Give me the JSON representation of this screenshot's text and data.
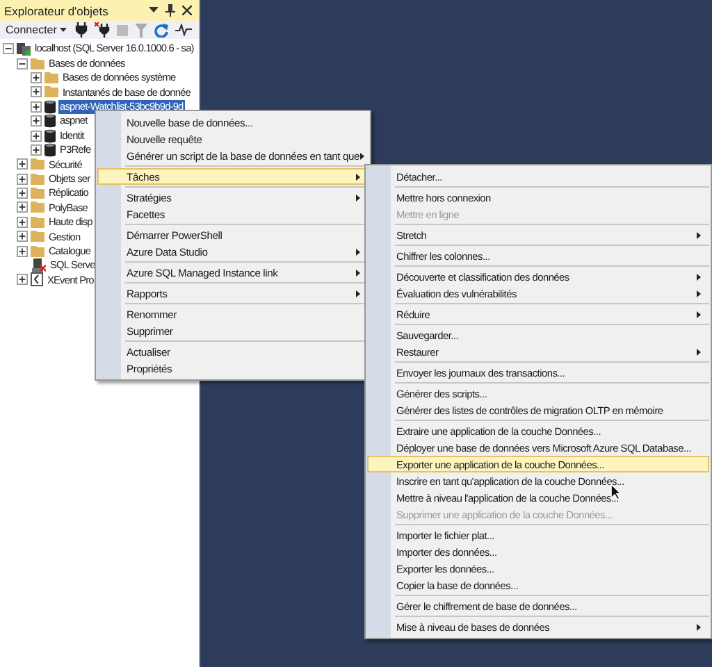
{
  "panel": {
    "title": "Explorateur d'objets",
    "connect_label": "Connecter"
  },
  "tree": [
    {
      "label": "localhost (SQL Server 16.0.1000.6 - sa)",
      "kind": "server",
      "expanded": true,
      "selected": false,
      "children": [
        {
          "label": "Bases de données",
          "kind": "folder",
          "expanded": true,
          "selected": false,
          "children": [
            {
              "label": "Bases de données système",
              "kind": "folder",
              "expanded": false,
              "selected": false
            },
            {
              "label": "Instantanés de base de donnée",
              "kind": "folder",
              "expanded": false,
              "selected": false
            },
            {
              "label": "aspnet-Watchlist-53bc9b9d-9d",
              "kind": "database",
              "expanded": false,
              "selected": true
            },
            {
              "label": "aspnet",
              "kind": "database",
              "expanded": false,
              "selected": false
            },
            {
              "label": "Identit",
              "kind": "database",
              "expanded": false,
              "selected": false
            },
            {
              "label": "P3Refe",
              "kind": "database",
              "expanded": false,
              "selected": false
            }
          ]
        },
        {
          "label": "Sécurité",
          "kind": "folder",
          "expanded": false,
          "selected": false
        },
        {
          "label": "Objets ser",
          "kind": "folder",
          "expanded": false,
          "selected": false
        },
        {
          "label": "Réplicatio",
          "kind": "folder",
          "expanded": false,
          "selected": false
        },
        {
          "label": "PolyBase",
          "kind": "folder",
          "expanded": false,
          "selected": false
        },
        {
          "label": "Haute disp",
          "kind": "folder",
          "expanded": false,
          "selected": false
        },
        {
          "label": "Gestion",
          "kind": "folder",
          "expanded": false,
          "selected": false
        },
        {
          "label": "Catalogue",
          "kind": "folder",
          "expanded": false,
          "selected": false
        },
        {
          "label": "SQL Serve",
          "kind": "agent",
          "selected": false
        },
        {
          "label": "XEvent Pro",
          "kind": "xevent",
          "expanded": false,
          "selected": false
        }
      ]
    }
  ],
  "context_menu": {
    "items": [
      {
        "kind": "item",
        "label": "Nouvelle base de données...",
        "submenu": false,
        "selected": false,
        "disabled": false
      },
      {
        "kind": "item",
        "label": "Nouvelle requête",
        "submenu": false,
        "selected": false,
        "disabled": false
      },
      {
        "kind": "item",
        "label": "Générer un script de la base de données en tant que",
        "submenu": true,
        "selected": false,
        "disabled": false
      },
      {
        "kind": "separator"
      },
      {
        "kind": "item",
        "label": "Tâches",
        "submenu": true,
        "selected": true,
        "disabled": false
      },
      {
        "kind": "separator"
      },
      {
        "kind": "item",
        "label": "Stratégies",
        "submenu": true,
        "selected": false,
        "disabled": false
      },
      {
        "kind": "item",
        "label": "Facettes",
        "submenu": false,
        "selected": false,
        "disabled": false
      },
      {
        "kind": "separator"
      },
      {
        "kind": "item",
        "label": "Démarrer PowerShell",
        "submenu": false,
        "selected": false,
        "disabled": false
      },
      {
        "kind": "item",
        "label": "Azure Data Studio",
        "submenu": true,
        "selected": false,
        "disabled": false
      },
      {
        "kind": "separator"
      },
      {
        "kind": "item",
        "label": "Azure SQL Managed Instance link",
        "submenu": true,
        "selected": false,
        "disabled": false
      },
      {
        "kind": "separator"
      },
      {
        "kind": "item",
        "label": "Rapports",
        "submenu": true,
        "selected": false,
        "disabled": false
      },
      {
        "kind": "separator"
      },
      {
        "kind": "item",
        "label": "Renommer",
        "submenu": false,
        "selected": false,
        "disabled": false
      },
      {
        "kind": "item",
        "label": "Supprimer",
        "submenu": false,
        "selected": false,
        "disabled": false
      },
      {
        "kind": "separator"
      },
      {
        "kind": "item",
        "label": "Actualiser",
        "submenu": false,
        "selected": false,
        "disabled": false
      },
      {
        "kind": "item",
        "label": "Propriétés",
        "submenu": false,
        "selected": false,
        "disabled": false
      }
    ]
  },
  "submenu": {
    "items": [
      {
        "kind": "item",
        "label": "Détacher...",
        "submenu": false,
        "selected": false,
        "disabled": false
      },
      {
        "kind": "separator"
      },
      {
        "kind": "item",
        "label": "Mettre hors connexion",
        "submenu": false,
        "selected": false,
        "disabled": false
      },
      {
        "kind": "item",
        "label": "Mettre en ligne",
        "submenu": false,
        "selected": false,
        "disabled": true
      },
      {
        "kind": "separator"
      },
      {
        "kind": "item",
        "label": "Stretch",
        "submenu": true,
        "selected": false,
        "disabled": false
      },
      {
        "kind": "separator"
      },
      {
        "kind": "item",
        "label": "Chiffrer les colonnes...",
        "submenu": false,
        "selected": false,
        "disabled": false
      },
      {
        "kind": "separator"
      },
      {
        "kind": "item",
        "label": "Découverte et classification des données",
        "submenu": true,
        "selected": false,
        "disabled": false
      },
      {
        "kind": "item",
        "label": "Évaluation des vulnérabilités",
        "submenu": true,
        "selected": false,
        "disabled": false
      },
      {
        "kind": "separator"
      },
      {
        "kind": "item",
        "label": "Réduire",
        "submenu": true,
        "selected": false,
        "disabled": false
      },
      {
        "kind": "separator"
      },
      {
        "kind": "item",
        "label": "Sauvegarder...",
        "submenu": false,
        "selected": false,
        "disabled": false
      },
      {
        "kind": "item",
        "label": "Restaurer",
        "submenu": true,
        "selected": false,
        "disabled": false
      },
      {
        "kind": "separator"
      },
      {
        "kind": "item",
        "label": "Envoyer les journaux des transactions...",
        "submenu": false,
        "selected": false,
        "disabled": false
      },
      {
        "kind": "separator"
      },
      {
        "kind": "item",
        "label": "Générer des scripts...",
        "submenu": false,
        "selected": false,
        "disabled": false
      },
      {
        "kind": "item",
        "label": "Générer des listes de contrôles de migration OLTP en mémoire",
        "submenu": false,
        "selected": false,
        "disabled": false
      },
      {
        "kind": "separator"
      },
      {
        "kind": "item",
        "label": "Extraire une application de la couche Données...",
        "submenu": false,
        "selected": false,
        "disabled": false
      },
      {
        "kind": "item",
        "label": "Déployer une base de données vers Microsoft Azure SQL Database...",
        "submenu": false,
        "selected": false,
        "disabled": false
      },
      {
        "kind": "item",
        "label": "Exporter une application de la couche Données...",
        "submenu": false,
        "selected": true,
        "disabled": false
      },
      {
        "kind": "item",
        "label": "Inscrire en tant qu'application de la couche Données...",
        "submenu": false,
        "selected": false,
        "disabled": false
      },
      {
        "kind": "item",
        "label": "Mettre à niveau l'application de la couche Données...",
        "submenu": false,
        "selected": false,
        "disabled": false
      },
      {
        "kind": "item",
        "label": "Supprimer une application de la couche Données...",
        "submenu": false,
        "selected": false,
        "disabled": true
      },
      {
        "kind": "separator"
      },
      {
        "kind": "item",
        "label": "Importer le fichier plat...",
        "submenu": false,
        "selected": false,
        "disabled": false
      },
      {
        "kind": "item",
        "label": "Importer des données...",
        "submenu": false,
        "selected": false,
        "disabled": false
      },
      {
        "kind": "item",
        "label": "Exporter les données...",
        "submenu": false,
        "selected": false,
        "disabled": false
      },
      {
        "kind": "item",
        "label": "Copier la base de données...",
        "submenu": false,
        "selected": false,
        "disabled": false
      },
      {
        "kind": "separator"
      },
      {
        "kind": "item",
        "label": "Gérer le chiffrement de base de données...",
        "submenu": false,
        "selected": false,
        "disabled": false
      },
      {
        "kind": "separator"
      },
      {
        "kind": "item",
        "label": "Mise à niveau de bases de données",
        "submenu": true,
        "selected": false,
        "disabled": false
      }
    ]
  }
}
